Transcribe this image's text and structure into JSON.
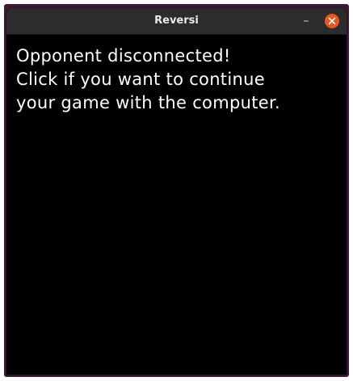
{
  "window": {
    "title": "Reversi",
    "minimize_symbol": "–",
    "close_icon": "close-icon"
  },
  "content": {
    "message_lines": [
      "Opponent disconnected!",
      "Click if you want to continue",
      "your game with the computer."
    ]
  },
  "colors": {
    "titlebar": "#2c2c2c",
    "content_background": "#000000",
    "text": "#ffffff",
    "close_button": "#e95420"
  }
}
